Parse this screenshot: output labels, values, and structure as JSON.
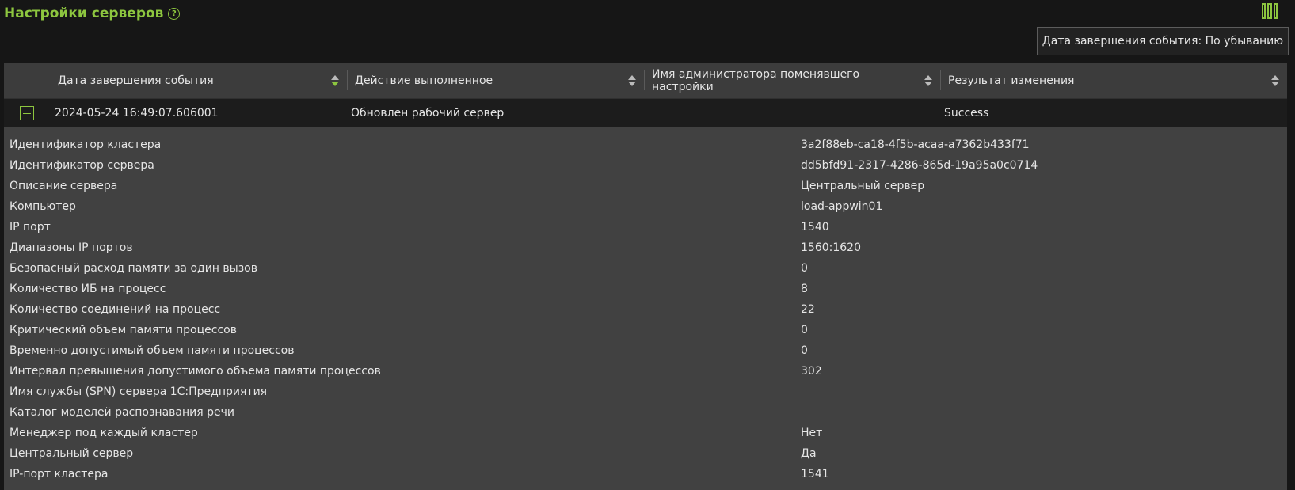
{
  "page": {
    "title": "Настройки серверов",
    "help_glyph": "?",
    "sort_indicator": "Дата завершения события: По убыванию"
  },
  "colors": {
    "accent": "#8dc63f",
    "background": "#161616",
    "grid": "#414141"
  },
  "table": {
    "columns": [
      {
        "label": "Дата завершения события",
        "sorted": "desc"
      },
      {
        "label": "Действие выполненное"
      },
      {
        "label": "Имя администратора поменявшего настройки"
      },
      {
        "label": "Результат изменения"
      }
    ],
    "row": {
      "date": "2024-05-24 16:49:07.606001",
      "action": "Обновлен рабочий сервер",
      "admin": "",
      "result": "Success"
    },
    "details": [
      {
        "key": "Идентификатор кластера",
        "value": "3a2f88eb-ca18-4f5b-acaa-a7362b433f71"
      },
      {
        "key": "Идентификатор сервера",
        "value": "dd5bfd91-2317-4286-865d-19a95a0c0714"
      },
      {
        "key": "Описание сервера",
        "value": "Центральный сервер"
      },
      {
        "key": "Компьютер",
        "value": "load-appwin01"
      },
      {
        "key": "IP порт",
        "value": "1540"
      },
      {
        "key": "Диапазоны IP портов",
        "value": "1560:1620"
      },
      {
        "key": "Безопасный расход памяти за один вызов",
        "value": "0"
      },
      {
        "key": "Количество ИБ на процесс",
        "value": "8"
      },
      {
        "key": "Количество соединений на процесс",
        "value": "22"
      },
      {
        "key": "Критический объем памяти процессов",
        "value": "0"
      },
      {
        "key": "Временно допустимый объем памяти процессов",
        "value": "0"
      },
      {
        "key": "Интервал превышения допустимого объема памяти процессов",
        "value": "302"
      },
      {
        "key": "Имя службы (SPN) сервера 1С:Предприятия",
        "value": ""
      },
      {
        "key": "Каталог моделей распознавания речи",
        "value": ""
      },
      {
        "key": "Менеджер под каждый кластер",
        "value": "Нет"
      },
      {
        "key": "Центральный сервер",
        "value": "Да"
      },
      {
        "key": "IP-порт кластера",
        "value": "1541"
      }
    ]
  }
}
